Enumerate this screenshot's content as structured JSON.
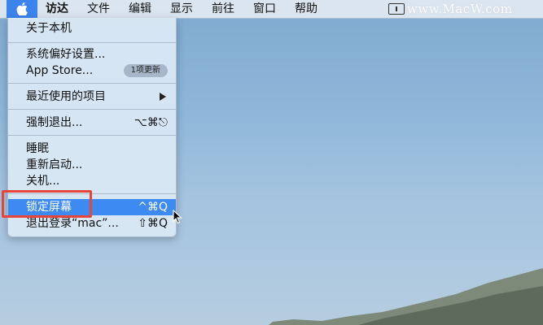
{
  "menubar": {
    "apple_icon": "apple-logo-icon",
    "items": [
      "访达",
      "文件",
      "编辑",
      "显示",
      "前往",
      "窗口",
      "帮助"
    ],
    "watermark": "www.MacW.com"
  },
  "apple_menu": {
    "about": "关于本机",
    "system_prefs": "系统偏好设置...",
    "app_store": "App Store...",
    "app_store_badge": "1项更新",
    "recent_items": "最近使用的项目",
    "force_quit": "强制退出...",
    "force_quit_shortcut": "⌥⌘⎋",
    "sleep": "睡眠",
    "restart": "重新启动...",
    "shutdown": "关机...",
    "lock_screen": "锁定屏幕",
    "lock_screen_shortcut": "^⌘Q",
    "logout": "退出登录“mac”...",
    "logout_shortcut": "⇧⌘Q"
  },
  "colors": {
    "highlight": "#3d8af3",
    "annotation": "#e8443a",
    "apple_selected": "#3b84ee"
  }
}
